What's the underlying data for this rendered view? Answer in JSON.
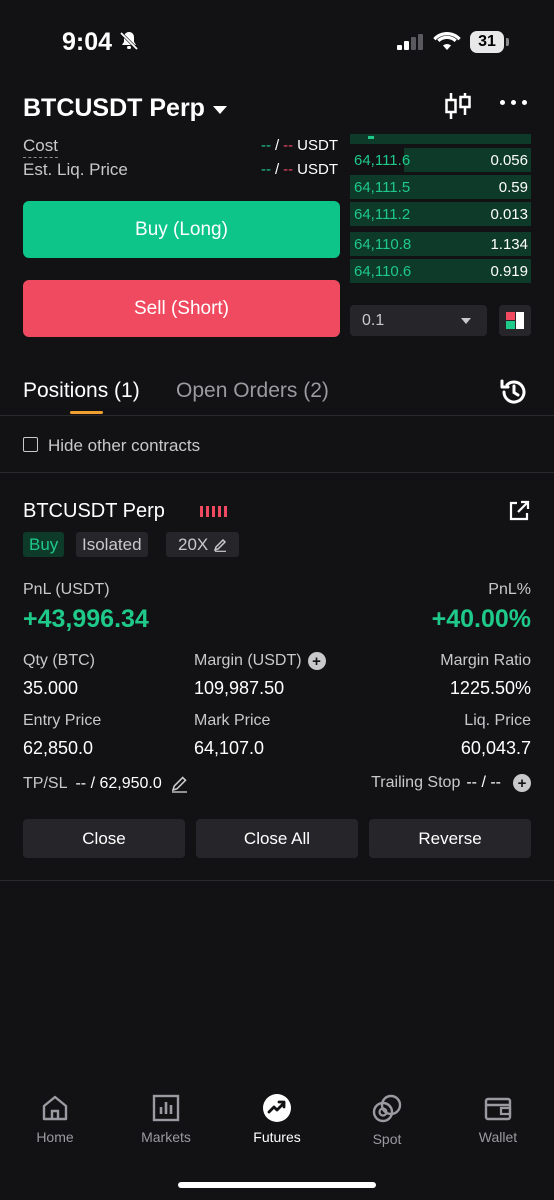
{
  "status_bar": {
    "time": "9:04",
    "battery": "31"
  },
  "header": {
    "symbol": "BTCUSDT Perp"
  },
  "order_form": {
    "cost_label": "Cost",
    "liq_label": "Est. Liq. Price",
    "dash_g": "--",
    "slash": "/",
    "dash_r": "--",
    "unit": "USDT",
    "buy_label": "Buy (Long)",
    "sell_label": "Sell (Short)"
  },
  "order_book": {
    "rows": [
      {
        "price": "64,111.6",
        "qty": "0.056",
        "depth": 0.7
      },
      {
        "price": "64,111.5",
        "qty": "0.59",
        "depth": 1.0
      },
      {
        "price": "64,111.2",
        "qty": "0.013",
        "depth": 1.0
      },
      {
        "price": "64,110.8",
        "qty": "1.134",
        "depth": 1.0
      },
      {
        "price": "64,110.6",
        "qty": "0.919",
        "depth": 1.0
      }
    ],
    "precision": "0.1"
  },
  "tabs": {
    "positions": "Positions (1)",
    "orders": "Open Orders (2)"
  },
  "filter": {
    "hide_label": "Hide other contracts"
  },
  "position": {
    "symbol": "BTCUSDT Perp",
    "side": "Buy",
    "margin_mode": "Isolated",
    "leverage": "20X",
    "pnl_label": "PnL (USDT)",
    "pnl_value": "+43,996.34",
    "pnl_pct_label": "PnL%",
    "pnl_pct_value": "+40.00%",
    "qty_label": "Qty (BTC)",
    "qty_value": "35.000",
    "margin_label": "Margin (USDT)",
    "margin_value": "109,987.50",
    "margin_ratio_label": "Margin Ratio",
    "margin_ratio_value": "1225.50%",
    "entry_label": "Entry Price",
    "entry_value": "62,850.0",
    "mark_label": "Mark Price",
    "mark_value": "64,107.0",
    "liq_label": "Liq. Price",
    "liq_value": "60,043.7",
    "tpsl_label": "TP/SL",
    "tpsl_value": "-- / 62,950.0",
    "trailing_label": "Trailing Stop",
    "trailing_value": "-- / --",
    "close_label": "Close",
    "close_all_label": "Close All",
    "reverse_label": "Reverse"
  },
  "nav": {
    "home": "Home",
    "markets": "Markets",
    "futures": "Futures",
    "spot": "Spot",
    "wallet": "Wallet"
  },
  "colors": {
    "green": "#1ec98a",
    "red": "#ef4a5f",
    "accent": "#f0a030",
    "background": "#121214"
  }
}
